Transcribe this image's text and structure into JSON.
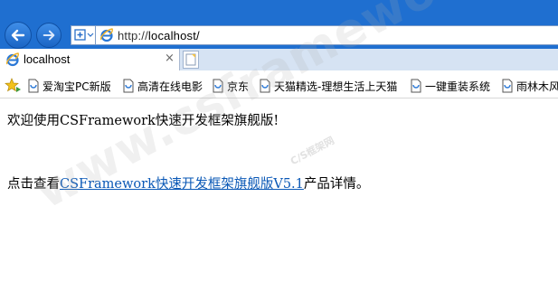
{
  "browser": {
    "address_prefix": "http://",
    "address_host": "localhost/",
    "tab_label": "localhost",
    "tab_close": "×"
  },
  "favorites": [
    {
      "label": "爱淘宝PC新版"
    },
    {
      "label": "高清在线电影"
    },
    {
      "label": "京东"
    },
    {
      "label": "天猫精选-理想生活上天猫"
    },
    {
      "label": "一键重装系统"
    },
    {
      "label": "雨林木风"
    }
  ],
  "page": {
    "welcome": "欢迎使用CSFramework快速开发框架旗舰版!",
    "detail_prefix": "点击查看",
    "detail_link": "CSFramework快速开发框架旗舰版V5.1",
    "detail_suffix": "产品详情。"
  },
  "watermark": {
    "main": "www.csframework.com",
    "sub": "C/S框架网"
  },
  "colors": {
    "titlebar": "#1f6fd0",
    "link": "#0a58b6"
  },
  "icons": [
    "back-arrow-icon",
    "forward-arrow-icon",
    "add-favorite-icon",
    "ie-icon",
    "close-icon",
    "new-tab-icon",
    "favorites-star-icon",
    "page-icon"
  ]
}
